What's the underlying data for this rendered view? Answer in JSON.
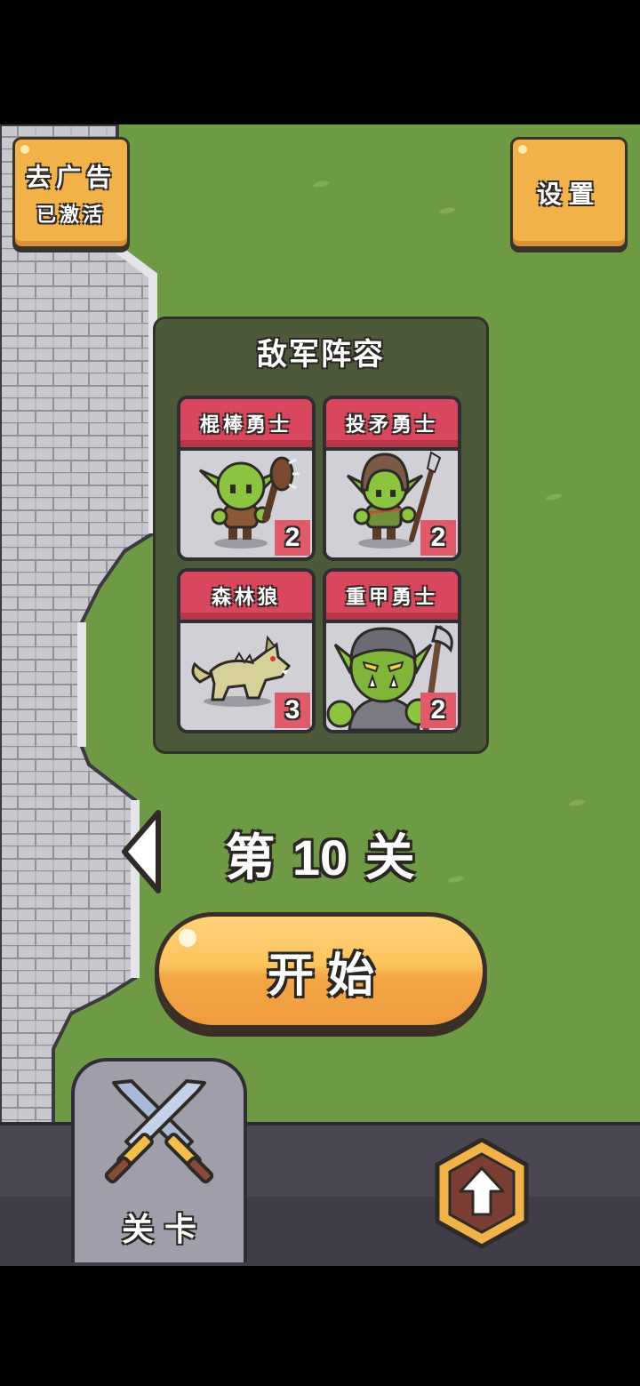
{
  "top_left_button": {
    "line1": "去广告",
    "line2": "已激活"
  },
  "settings_button": {
    "label": "设置"
  },
  "enemy_roster": {
    "title": "敌军阵容",
    "units": [
      {
        "name": "棍棒勇士",
        "count": "2",
        "icon": "club-goblin-icon"
      },
      {
        "name": "投矛勇士",
        "count": "2",
        "icon": "spear-goblin-icon"
      },
      {
        "name": "森林狼",
        "count": "3",
        "icon": "forest-wolf-icon"
      },
      {
        "name": "重甲勇士",
        "count": "2",
        "icon": "armored-orc-icon"
      }
    ]
  },
  "level": {
    "prefix": "第",
    "number": "10",
    "suffix": "关"
  },
  "start_button": {
    "label": "开始"
  },
  "bottom_nav": {
    "levels_tab": {
      "label": "关卡",
      "icon": "crossed-swords-icon"
    },
    "upgrade_button": {
      "icon": "upgrade-arrow-icon"
    }
  },
  "colors": {
    "grass": "#6e9a45",
    "button_orange": "#f2b24a",
    "card_header_red": "#d9475e",
    "roster_panel": "#4c5a3a",
    "bottom_bar": "#4a4753"
  }
}
